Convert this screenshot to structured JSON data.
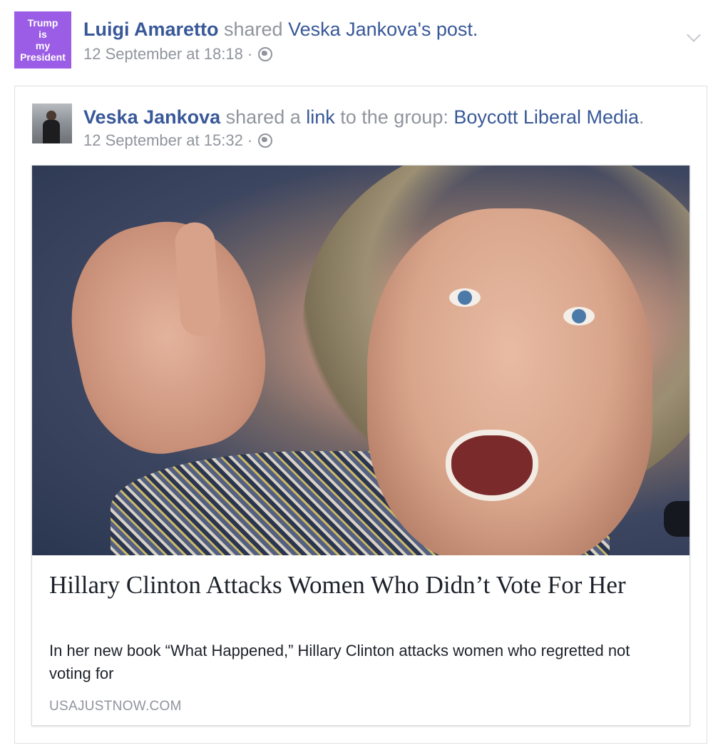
{
  "outer_post": {
    "avatar_lines": [
      "Trump",
      "is",
      "my",
      "President"
    ],
    "author": "Luigi Amaretto",
    "action": " shared ",
    "original_author": "Veska Jankova",
    "suffix": "'s post.",
    "timestamp": "12 September at 18:18 ·",
    "privacy_icon": "globe-icon",
    "menu_icon": "chevron-down-icon"
  },
  "shared_post": {
    "author": "Veska Jankova",
    "action_1": " shared a ",
    "link_word": "link",
    "action_2": " to the group: ",
    "group": "Boycott Liberal Media",
    "period": ".",
    "timestamp": "12 September at 15:32 ·",
    "privacy_icon": "globe-icon"
  },
  "link_card": {
    "title": "Hillary Clinton Attacks Women Who Didn’t Vote For Her",
    "description": "In her new book “What Happened,” Hillary Clinton attacks women who regretted not voting for",
    "domain": "USAJUSTNOW.COM"
  },
  "colors": {
    "link": "#385898",
    "muted": "#90949c",
    "avatar_bg": "#9b5de5",
    "border": "#dddfe2"
  }
}
